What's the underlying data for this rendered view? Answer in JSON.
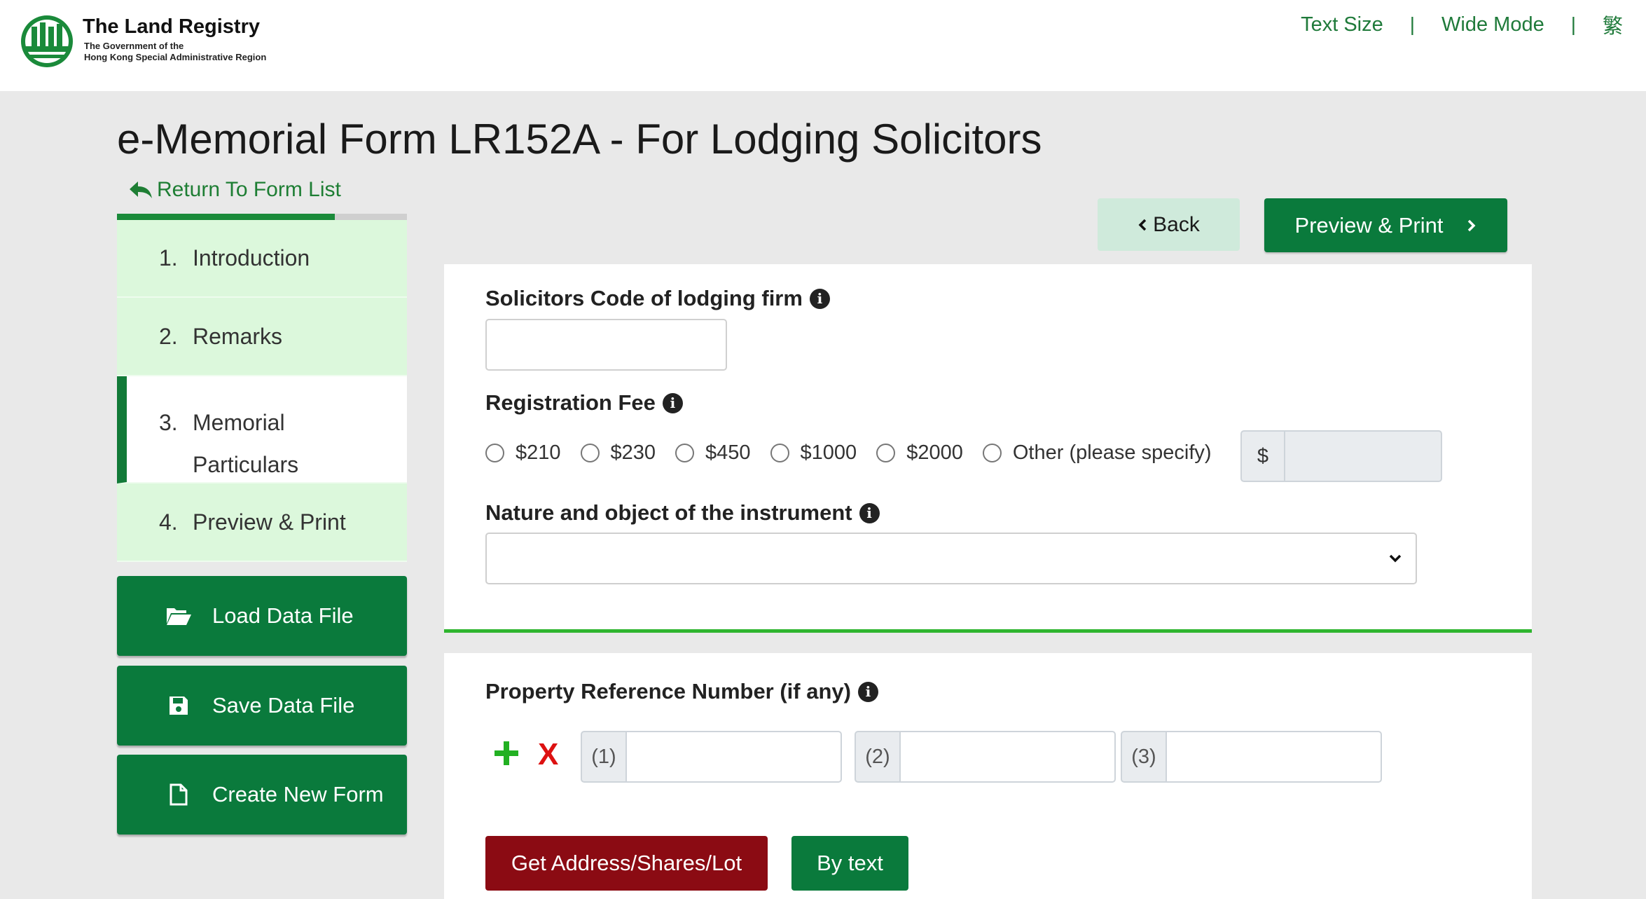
{
  "header": {
    "brand_title": "The Land Registry",
    "brand_sub_line1": "The Government of the",
    "brand_sub_line2": "Hong Kong Special Administrative Region",
    "links": {
      "text_size": "Text Size",
      "wide_mode": "Wide Mode",
      "language": "繁"
    },
    "separator": "|"
  },
  "page": {
    "title": "e-Memorial Form LR152A - For Lodging Solicitors",
    "return_link": "Return To Form List",
    "progress_fraction": 0.75
  },
  "steps": [
    {
      "num": "1.",
      "label": "Introduction"
    },
    {
      "num": "2.",
      "label": "Remarks"
    },
    {
      "num": "3.",
      "label_line1": "Memorial",
      "label_line2": "Particulars",
      "active": true
    },
    {
      "num": "4.",
      "label": "Preview & Print"
    }
  ],
  "sidebar_buttons": {
    "load": "Load Data File",
    "save": "Save Data File",
    "new_form": "Create New Form"
  },
  "nav_buttons": {
    "back": "Back",
    "preview": "Preview & Print"
  },
  "form": {
    "solicitors_code_label": "Solicitors Code of lodging firm",
    "solicitors_code_value": "",
    "registration_fee_label": "Registration Fee",
    "fee_options": [
      "$210",
      "$230",
      "$450",
      "$1000",
      "$2000",
      "Other (please specify)"
    ],
    "other_currency": "$",
    "nature_label": "Nature and object of the instrument",
    "nature_value": "",
    "property_ref_label": "Property Reference Number (if any)",
    "ref_prefixes": [
      "(1)",
      "(2)",
      "(3)"
    ],
    "remove_symbol": "X",
    "get_address_button": "Get Address/Shares/Lot",
    "by_text_button": "By text"
  },
  "colors": {
    "primary_green": "#0a7a3c",
    "step_bg": "#dcf8dc",
    "danger": "#8b0b13",
    "accent_line": "#2fb52f"
  }
}
